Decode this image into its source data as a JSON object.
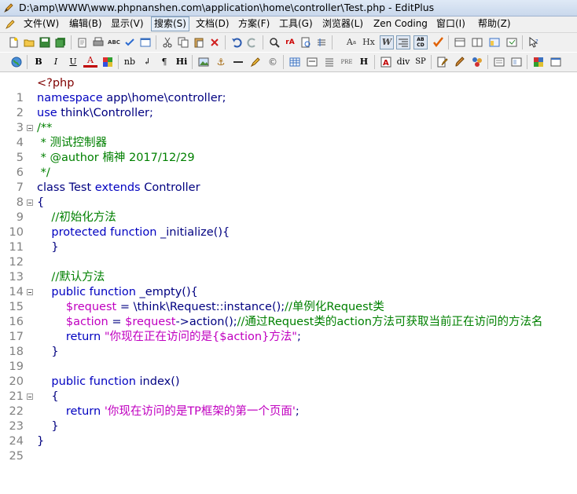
{
  "window": {
    "title": "D:\\amp\\WWW\\www.phpnanshen.com\\application\\home\\controller\\Test.php - EditPlus"
  },
  "menu": [
    "文件(W)",
    "编辑(B)",
    "显示(V)",
    "搜索(S)",
    "文档(D)",
    "方案(F)",
    "工具(G)",
    "浏览器(L)",
    "Zen Coding",
    "窗口(I)",
    "帮助(Z)"
  ],
  "toolbar2_labels": {
    "bold": "B",
    "italic": "I",
    "underline": "U",
    "font": "A",
    "nb": "nb",
    "br": "↲",
    "para": "¶",
    "hx": "H",
    "hi": "Hi",
    "pre": "PRE",
    "div": "div",
    "sp": "SP",
    "hx2": "Hx",
    "w": "W"
  },
  "colors": {
    "keyword": "#0000c0",
    "class": "#000080",
    "comment": "#008000",
    "variable": "#c000c0",
    "string": "#b00000",
    "number": "#008000"
  },
  "code": {
    "line_numbers": [
      "1",
      "2",
      "3",
      "4",
      "5",
      "6",
      "7",
      "8",
      "9",
      "10",
      "11",
      "12",
      "13",
      "14",
      "15",
      "16",
      "17",
      "18",
      "19",
      "20",
      "21",
      "22",
      "23",
      "24",
      "25"
    ],
    "l1": "<?php",
    "l2a": "namespace",
    "l2b": " app\\home\\controller;",
    "l3a": "use",
    "l3b": " think\\Controller;",
    "l4": "/**",
    "l5": " * 测试控制器",
    "l6": " * @author 楠神 2017/12/29",
    "l7": " */",
    "l8a": "class",
    "l8b": " Test",
    "l8c": " extends",
    "l8d": " Controller",
    "l9": "{",
    "l10": "    //初始化方法",
    "l11a": "    protected",
    "l11b": " function",
    "l11c": " _initialize(){",
    "l12": "    }",
    "l14": "    //默认方法",
    "l15a": "    public",
    "l15b": " function",
    "l15c": " _empty(){",
    "l16a": "        $request",
    "l16b": " = \\think\\Request::instance();",
    "l16c": "//单例化Request类",
    "l17a": "        $action",
    "l17b": " = ",
    "l17c": "$request",
    "l17d": "->action();",
    "l17e": "//通过Request类的action方法可获取当前正在访问的方法名",
    "l18a": "        return",
    "l18b": " \"你现在正在访问的是{$action}方法\"",
    "l18c": ";",
    "l19": "    }",
    "l21a": "    public",
    "l21b": " function",
    "l21c": " index()",
    "l22": "    {",
    "l23a": "        return",
    "l23b": " '你现在访问的是TP框架的第一个页面'",
    "l23c": ";",
    "l24": "    }",
    "l25": "}"
  }
}
